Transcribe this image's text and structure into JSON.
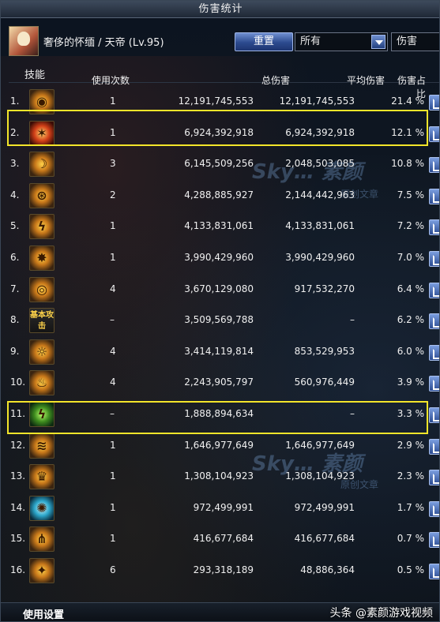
{
  "window": {
    "title": "伤害统计"
  },
  "header": {
    "character": "奢侈的怀缅 / 天帝 (Lv.95)",
    "reset_label": "重置",
    "filter_value": "所有",
    "metric_value": "伤害"
  },
  "table": {
    "columns": [
      "技能",
      "使用次数",
      "总伤害",
      "平均伤害",
      "伤害占比"
    ],
    "rows": [
      {
        "rank": "1.",
        "icon": "eye-triple-icon",
        "uses": "1",
        "total": "12,191,745,553",
        "avg": "12,191,745,553",
        "pct": "21.4 %"
      },
      {
        "rank": "2.",
        "icon": "flame-hand-icon",
        "uses": "1",
        "total": "6,924,392,918",
        "avg": "6,924,392,918",
        "pct": "12.1 %"
      },
      {
        "rank": "3.",
        "icon": "crescent-slash-icon",
        "uses": "3",
        "total": "6,145,509,256",
        "avg": "2,048,503,085",
        "pct": "10.8 %"
      },
      {
        "rank": "4.",
        "icon": "spiral-eye-icon",
        "uses": "2",
        "total": "4,288,885,927",
        "avg": "2,144,442,963",
        "pct": "7.5 %"
      },
      {
        "rank": "5.",
        "icon": "lightning-fist-icon",
        "uses": "1",
        "total": "4,133,831,061",
        "avg": "4,133,831,061",
        "pct": "7.2 %"
      },
      {
        "rank": "6.",
        "icon": "burst-strike-icon",
        "uses": "1",
        "total": "3,990,429,960",
        "avg": "3,990,429,960",
        "pct": "7.0 %"
      },
      {
        "rank": "7.",
        "icon": "rune-circle-icon",
        "uses": "4",
        "total": "3,670,129,080",
        "avg": "917,532,270",
        "pct": "6.4 %"
      },
      {
        "rank": "8.",
        "icon": "basic-attack-icon",
        "icon_text": "基本攻击",
        "uses": "–",
        "total": "3,509,569,788",
        "avg": "–",
        "pct": "6.2 %"
      },
      {
        "rank": "9.",
        "icon": "sun-face-icon",
        "uses": "4",
        "total": "3,414,119,814",
        "avg": "853,529,953",
        "pct": "6.0 %"
      },
      {
        "rank": "10.",
        "icon": "fire-wave-icon",
        "uses": "4",
        "total": "2,243,905,797",
        "avg": "560,976,449",
        "pct": "3.9 %"
      },
      {
        "rank": "11.",
        "icon": "green-bolt-icon",
        "uses": "–",
        "total": "1,888,894,634",
        "avg": "–",
        "pct": "3.3 %"
      },
      {
        "rank": "12.",
        "icon": "wind-orb-icon",
        "uses": "1",
        "total": "1,646,977,649",
        "avg": "1,646,977,649",
        "pct": "2.9 %"
      },
      {
        "rank": "13.",
        "icon": "crown-fist-icon",
        "uses": "1",
        "total": "1,308,104,923",
        "avg": "1,308,104,923",
        "pct": "2.3 %"
      },
      {
        "rank": "14.",
        "icon": "cyan-burst-icon",
        "uses": "1",
        "total": "972,499,991",
        "avg": "972,499,991",
        "pct": "1.7 %"
      },
      {
        "rank": "15.",
        "icon": "shield-rays-icon",
        "uses": "1",
        "total": "416,677,684",
        "avg": "416,677,684",
        "pct": "0.7 %"
      },
      {
        "rank": "16.",
        "icon": "golden-dash-icon",
        "uses": "6",
        "total": "293,318,189",
        "avg": "48,886,364",
        "pct": "0.5 %"
      }
    ]
  },
  "footer": {
    "settings_label": "使用设置",
    "watermark": "头条 @素颜游戏视频"
  },
  "background_watermark": {
    "logo": "Sky… 素颜",
    "sub": "原创文章"
  },
  "colors": {
    "highlight": "#f3e52a",
    "accent_button": "#2c4a8e"
  }
}
